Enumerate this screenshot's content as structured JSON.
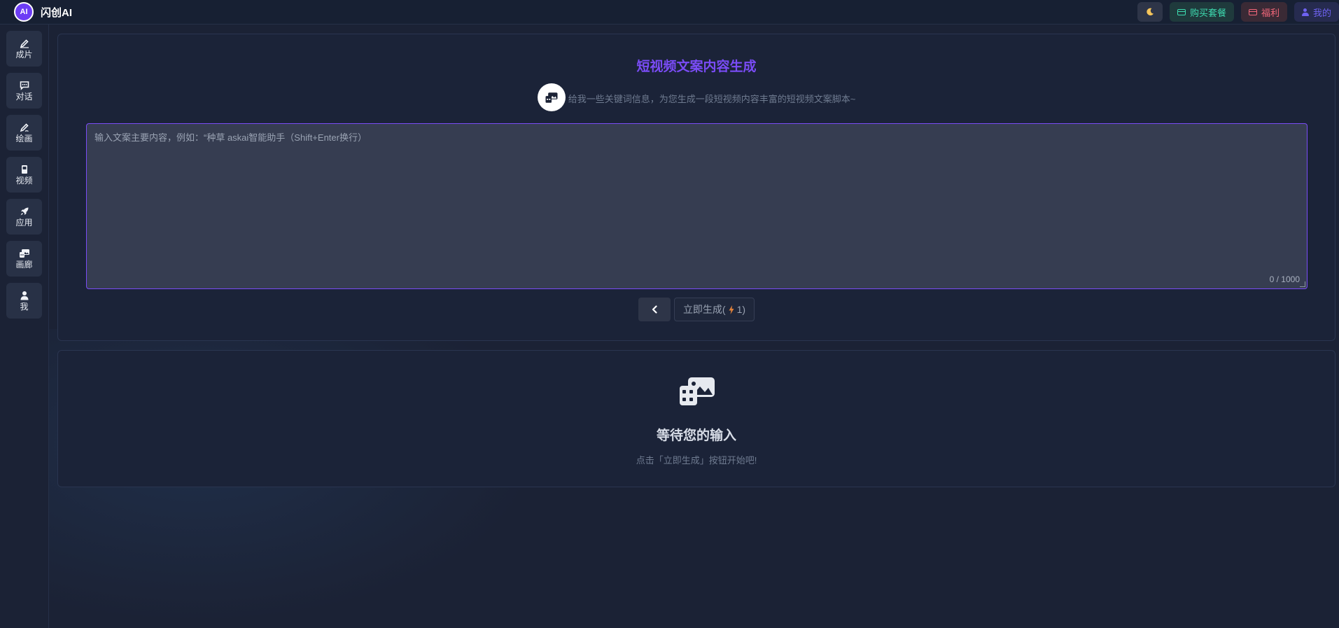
{
  "app": {
    "logo_text": "AI",
    "title": "闪创AI"
  },
  "topbar": {
    "theme_toggle_icon": "moon-icon",
    "buy_label": "购买套餐",
    "welfare_label": "福利",
    "mine_label": "我的"
  },
  "sidebar": {
    "items": [
      {
        "label": "成片",
        "icon": "edit-icon"
      },
      {
        "label": "对话",
        "icon": "chat-icon"
      },
      {
        "label": "绘画",
        "icon": "paint-icon"
      },
      {
        "label": "视频",
        "icon": "video-icon"
      },
      {
        "label": "应用",
        "icon": "rocket-icon"
      },
      {
        "label": "画廊",
        "icon": "gallery-icon"
      },
      {
        "label": "我",
        "icon": "user-icon"
      }
    ]
  },
  "main": {
    "title": "短视频文案内容生成",
    "subtitle": "给我一些关键词信息，为您生成一段短视频内容丰富的短视频文案脚本~",
    "input_placeholder": "输入文案主要内容，例如：“种草 askai智能助手（Shift+Enter换行）",
    "input_value": "",
    "counter": "0 / 1000",
    "generate_prefix": "立即生成(",
    "generate_cost": "1)"
  },
  "result": {
    "title": "等待您的输入",
    "hint": "点击「立即生成」按钮开始吧!"
  },
  "colors": {
    "accent": "#7a4cf6",
    "buy": "#3ddbb0",
    "welfare": "#f2677a",
    "mine": "#6e62f0",
    "moon": "#f6c55b",
    "bolt": "#e2823a"
  }
}
